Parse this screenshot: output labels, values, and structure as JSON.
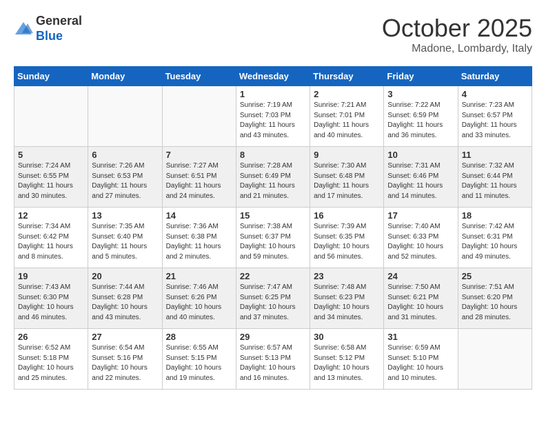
{
  "header": {
    "logo_general": "General",
    "logo_blue": "Blue",
    "month_title": "October 2025",
    "location": "Madone, Lombardy, Italy"
  },
  "days_of_week": [
    "Sunday",
    "Monday",
    "Tuesday",
    "Wednesday",
    "Thursday",
    "Friday",
    "Saturday"
  ],
  "weeks": [
    [
      {
        "day": "",
        "info": ""
      },
      {
        "day": "",
        "info": ""
      },
      {
        "day": "",
        "info": ""
      },
      {
        "day": "1",
        "info": "Sunrise: 7:19 AM\nSunset: 7:03 PM\nDaylight: 11 hours\nand 43 minutes."
      },
      {
        "day": "2",
        "info": "Sunrise: 7:21 AM\nSunset: 7:01 PM\nDaylight: 11 hours\nand 40 minutes."
      },
      {
        "day": "3",
        "info": "Sunrise: 7:22 AM\nSunset: 6:59 PM\nDaylight: 11 hours\nand 36 minutes."
      },
      {
        "day": "4",
        "info": "Sunrise: 7:23 AM\nSunset: 6:57 PM\nDaylight: 11 hours\nand 33 minutes."
      }
    ],
    [
      {
        "day": "5",
        "info": "Sunrise: 7:24 AM\nSunset: 6:55 PM\nDaylight: 11 hours\nand 30 minutes."
      },
      {
        "day": "6",
        "info": "Sunrise: 7:26 AM\nSunset: 6:53 PM\nDaylight: 11 hours\nand 27 minutes."
      },
      {
        "day": "7",
        "info": "Sunrise: 7:27 AM\nSunset: 6:51 PM\nDaylight: 11 hours\nand 24 minutes."
      },
      {
        "day": "8",
        "info": "Sunrise: 7:28 AM\nSunset: 6:49 PM\nDaylight: 11 hours\nand 21 minutes."
      },
      {
        "day": "9",
        "info": "Sunrise: 7:30 AM\nSunset: 6:48 PM\nDaylight: 11 hours\nand 17 minutes."
      },
      {
        "day": "10",
        "info": "Sunrise: 7:31 AM\nSunset: 6:46 PM\nDaylight: 11 hours\nand 14 minutes."
      },
      {
        "day": "11",
        "info": "Sunrise: 7:32 AM\nSunset: 6:44 PM\nDaylight: 11 hours\nand 11 minutes."
      }
    ],
    [
      {
        "day": "12",
        "info": "Sunrise: 7:34 AM\nSunset: 6:42 PM\nDaylight: 11 hours\nand 8 minutes."
      },
      {
        "day": "13",
        "info": "Sunrise: 7:35 AM\nSunset: 6:40 PM\nDaylight: 11 hours\nand 5 minutes."
      },
      {
        "day": "14",
        "info": "Sunrise: 7:36 AM\nSunset: 6:38 PM\nDaylight: 11 hours\nand 2 minutes."
      },
      {
        "day": "15",
        "info": "Sunrise: 7:38 AM\nSunset: 6:37 PM\nDaylight: 10 hours\nand 59 minutes."
      },
      {
        "day": "16",
        "info": "Sunrise: 7:39 AM\nSunset: 6:35 PM\nDaylight: 10 hours\nand 56 minutes."
      },
      {
        "day": "17",
        "info": "Sunrise: 7:40 AM\nSunset: 6:33 PM\nDaylight: 10 hours\nand 52 minutes."
      },
      {
        "day": "18",
        "info": "Sunrise: 7:42 AM\nSunset: 6:31 PM\nDaylight: 10 hours\nand 49 minutes."
      }
    ],
    [
      {
        "day": "19",
        "info": "Sunrise: 7:43 AM\nSunset: 6:30 PM\nDaylight: 10 hours\nand 46 minutes."
      },
      {
        "day": "20",
        "info": "Sunrise: 7:44 AM\nSunset: 6:28 PM\nDaylight: 10 hours\nand 43 minutes."
      },
      {
        "day": "21",
        "info": "Sunrise: 7:46 AM\nSunset: 6:26 PM\nDaylight: 10 hours\nand 40 minutes."
      },
      {
        "day": "22",
        "info": "Sunrise: 7:47 AM\nSunset: 6:25 PM\nDaylight: 10 hours\nand 37 minutes."
      },
      {
        "day": "23",
        "info": "Sunrise: 7:48 AM\nSunset: 6:23 PM\nDaylight: 10 hours\nand 34 minutes."
      },
      {
        "day": "24",
        "info": "Sunrise: 7:50 AM\nSunset: 6:21 PM\nDaylight: 10 hours\nand 31 minutes."
      },
      {
        "day": "25",
        "info": "Sunrise: 7:51 AM\nSunset: 6:20 PM\nDaylight: 10 hours\nand 28 minutes."
      }
    ],
    [
      {
        "day": "26",
        "info": "Sunrise: 6:52 AM\nSunset: 5:18 PM\nDaylight: 10 hours\nand 25 minutes."
      },
      {
        "day": "27",
        "info": "Sunrise: 6:54 AM\nSunset: 5:16 PM\nDaylight: 10 hours\nand 22 minutes."
      },
      {
        "day": "28",
        "info": "Sunrise: 6:55 AM\nSunset: 5:15 PM\nDaylight: 10 hours\nand 19 minutes."
      },
      {
        "day": "29",
        "info": "Sunrise: 6:57 AM\nSunset: 5:13 PM\nDaylight: 10 hours\nand 16 minutes."
      },
      {
        "day": "30",
        "info": "Sunrise: 6:58 AM\nSunset: 5:12 PM\nDaylight: 10 hours\nand 13 minutes."
      },
      {
        "day": "31",
        "info": "Sunrise: 6:59 AM\nSunset: 5:10 PM\nDaylight: 10 hours\nand 10 minutes."
      },
      {
        "day": "",
        "info": ""
      }
    ]
  ]
}
